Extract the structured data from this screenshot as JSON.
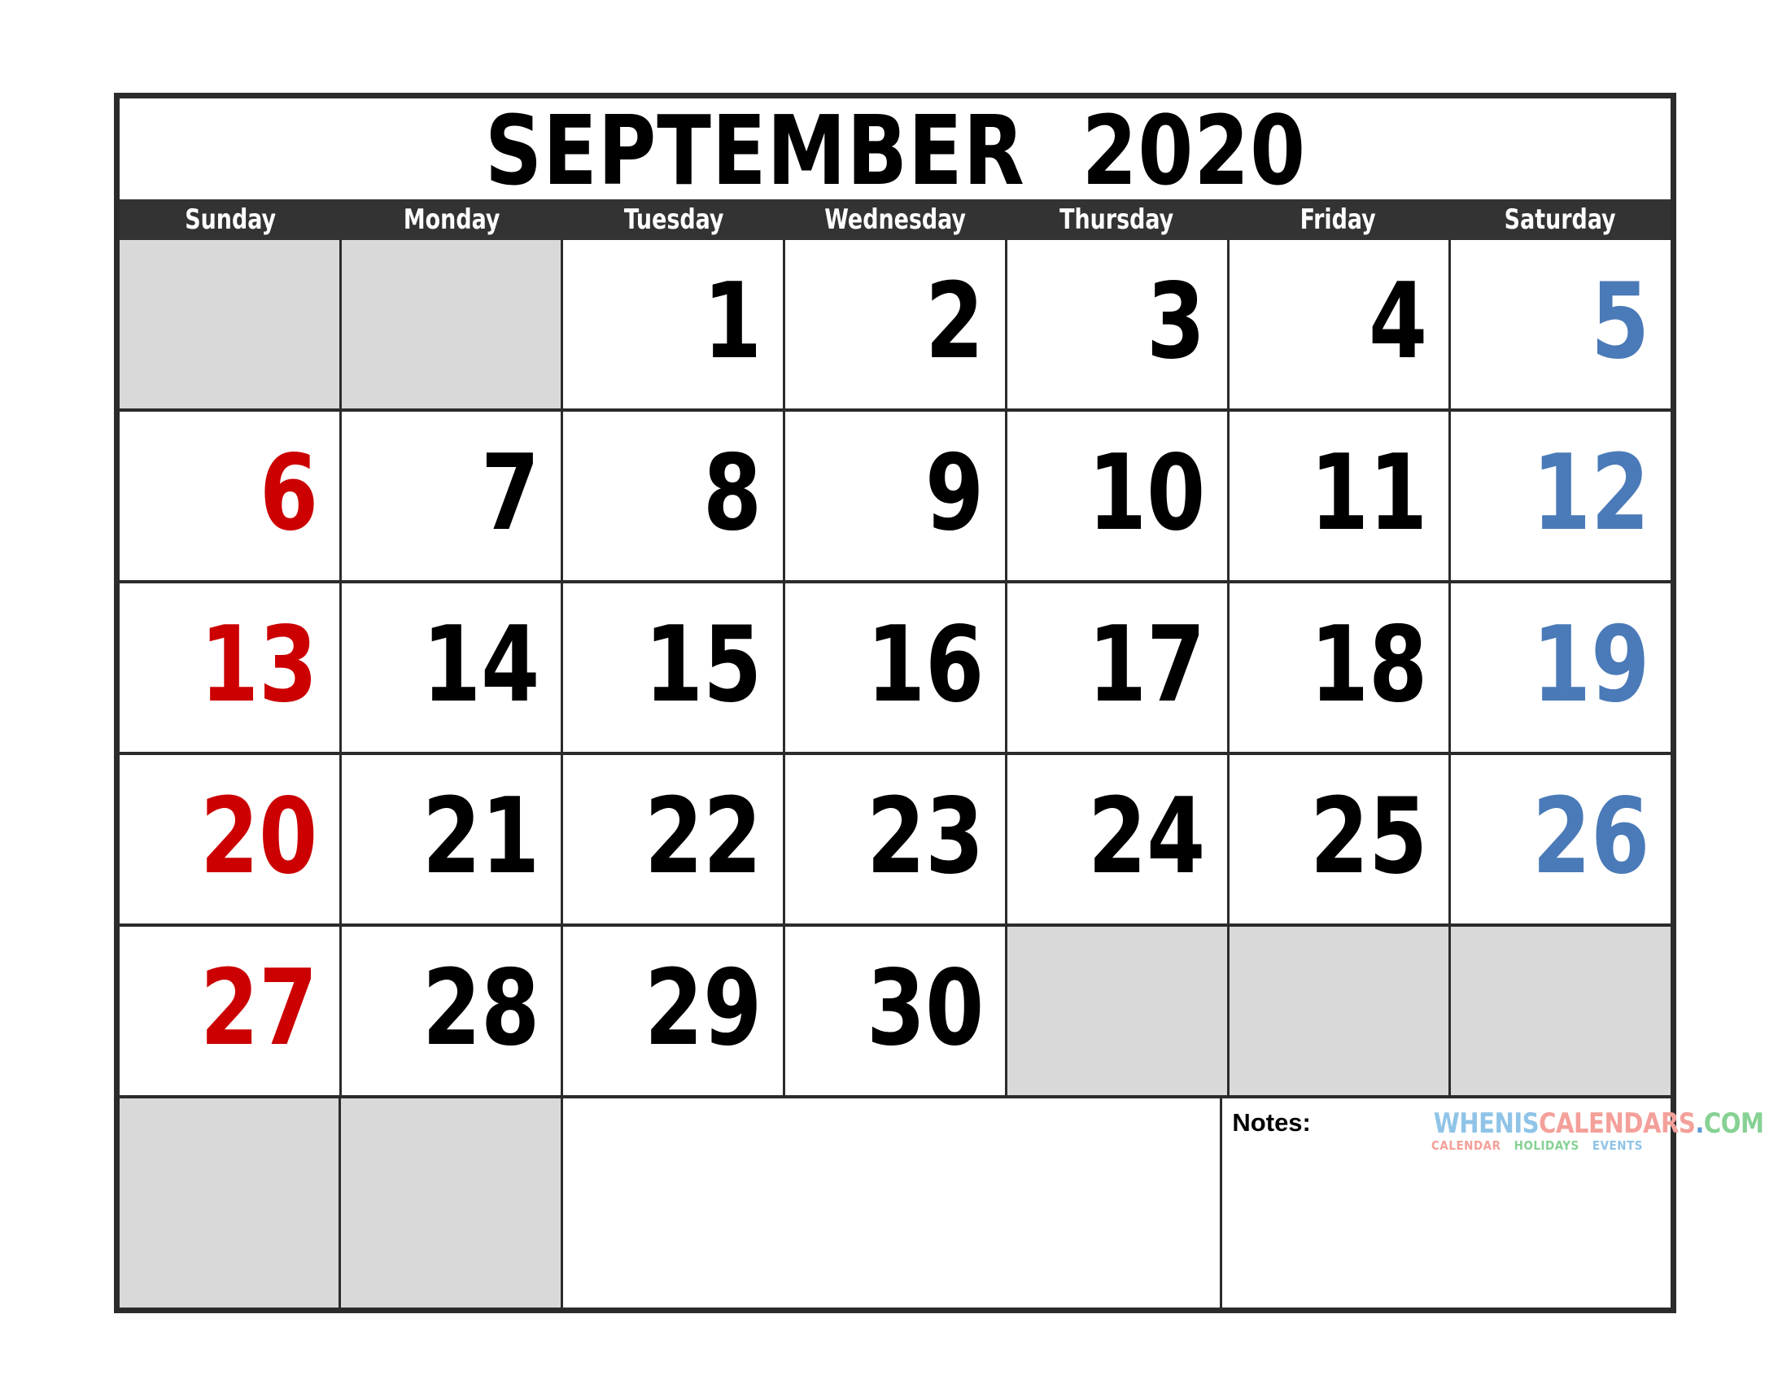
{
  "calendar": {
    "title": "SEPTEMBER  2020",
    "month_name": "SEPTEMBER",
    "year": "2020",
    "weekdays": [
      "Sunday",
      "Monday",
      "Tuesday",
      "Wednesday",
      "Thursday",
      "Friday",
      "Saturday"
    ],
    "weeks": [
      [
        {
          "day": "",
          "blank": true,
          "kind": "blank"
        },
        {
          "day": "",
          "blank": true,
          "kind": "blank"
        },
        {
          "day": "1",
          "blank": false,
          "kind": "weekday"
        },
        {
          "day": "2",
          "blank": false,
          "kind": "weekday"
        },
        {
          "day": "3",
          "blank": false,
          "kind": "weekday"
        },
        {
          "day": "4",
          "blank": false,
          "kind": "weekday"
        },
        {
          "day": "5",
          "blank": false,
          "kind": "saturday"
        }
      ],
      [
        {
          "day": "6",
          "blank": false,
          "kind": "sunday"
        },
        {
          "day": "7",
          "blank": false,
          "kind": "weekday"
        },
        {
          "day": "8",
          "blank": false,
          "kind": "weekday"
        },
        {
          "day": "9",
          "blank": false,
          "kind": "weekday"
        },
        {
          "day": "10",
          "blank": false,
          "kind": "weekday"
        },
        {
          "day": "11",
          "blank": false,
          "kind": "weekday"
        },
        {
          "day": "12",
          "blank": false,
          "kind": "saturday"
        }
      ],
      [
        {
          "day": "13",
          "blank": false,
          "kind": "sunday"
        },
        {
          "day": "14",
          "blank": false,
          "kind": "weekday"
        },
        {
          "day": "15",
          "blank": false,
          "kind": "weekday"
        },
        {
          "day": "16",
          "blank": false,
          "kind": "weekday"
        },
        {
          "day": "17",
          "blank": false,
          "kind": "weekday"
        },
        {
          "day": "18",
          "blank": false,
          "kind": "weekday"
        },
        {
          "day": "19",
          "blank": false,
          "kind": "saturday"
        }
      ],
      [
        {
          "day": "20",
          "blank": false,
          "kind": "sunday"
        },
        {
          "day": "21",
          "blank": false,
          "kind": "weekday"
        },
        {
          "day": "22",
          "blank": false,
          "kind": "weekday"
        },
        {
          "day": "23",
          "blank": false,
          "kind": "weekday"
        },
        {
          "day": "24",
          "blank": false,
          "kind": "weekday"
        },
        {
          "day": "25",
          "blank": false,
          "kind": "weekday"
        },
        {
          "day": "26",
          "blank": false,
          "kind": "saturday"
        }
      ],
      [
        {
          "day": "27",
          "blank": false,
          "kind": "sunday"
        },
        {
          "day": "28",
          "blank": false,
          "kind": "weekday"
        },
        {
          "day": "29",
          "blank": false,
          "kind": "weekday"
        },
        {
          "day": "30",
          "blank": false,
          "kind": "weekday"
        },
        {
          "day": "",
          "blank": true,
          "kind": "blank"
        },
        {
          "day": "",
          "blank": true,
          "kind": "blank"
        },
        {
          "day": "",
          "blank": true,
          "kind": "blank"
        }
      ]
    ],
    "notes": {
      "label": "Notes:",
      "value": ""
    },
    "brand": {
      "part1": "WHENIS",
      "part2": "CALENDARS",
      "part3": ".",
      "part4": "COM",
      "sub1": "CALENDAR",
      "sub2": "HOLIDAYS",
      "sub3": "EVENTS"
    },
    "colors": {
      "sunday": "#cc0000",
      "saturday": "#4a7ab8",
      "weekday": "#000000",
      "blank_cell": "#d9d9d9",
      "header_bar": "#333333",
      "border": "#2b2b2b",
      "background": "#ffffff",
      "brand_blue": "#8fc4e8",
      "brand_pink": "#f4a09a",
      "brand_green": "#86d194",
      "brand_dot": "#5b9bd5"
    }
  }
}
